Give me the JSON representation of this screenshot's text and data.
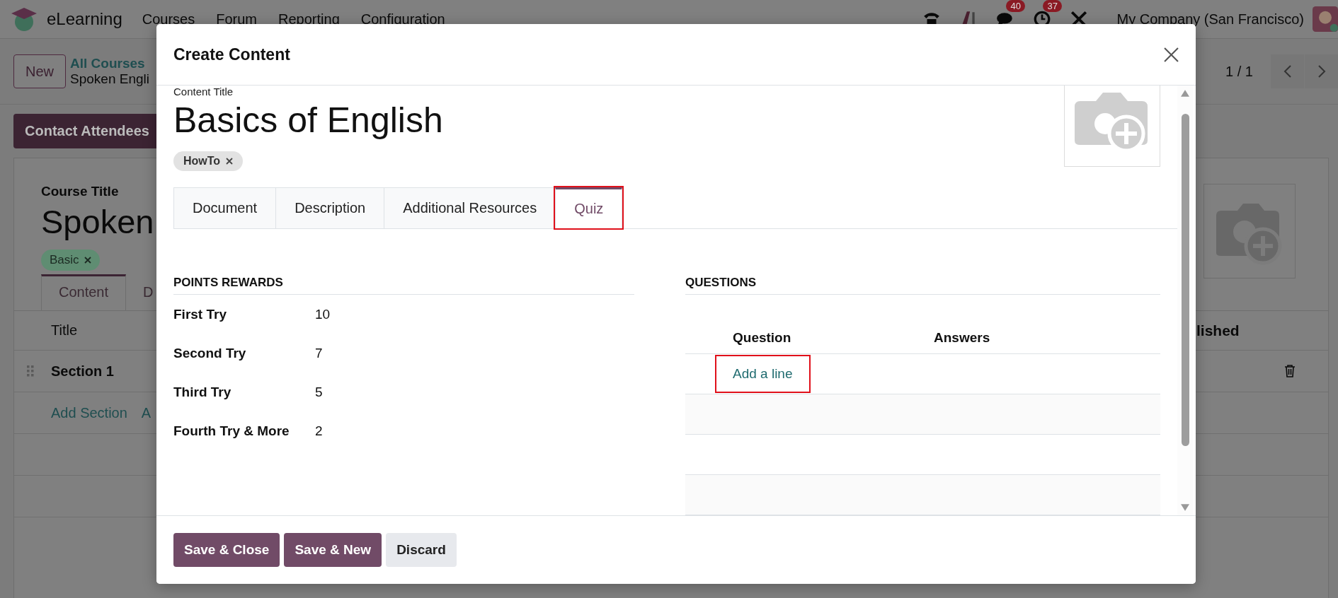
{
  "navbar": {
    "app_name": "eLearning",
    "menu": [
      "Courses",
      "Forum",
      "Reporting",
      "Configuration"
    ],
    "icons": [
      {
        "kind": "phone"
      },
      {
        "kind": "ai"
      },
      {
        "kind": "chat",
        "count": "40"
      },
      {
        "kind": "clock",
        "count": "37"
      },
      {
        "kind": "tools"
      }
    ],
    "company": "My Company (San Francisco)"
  },
  "control_panel": {
    "new_button": "New",
    "breadcrumb": [
      "All Courses",
      "Spoken Engli"
    ],
    "pager": "1 / 1"
  },
  "action_button": "Contact Attendees",
  "course_form": {
    "field_label": "Course Title",
    "title": "Spoken",
    "tag": "Basic",
    "tabs": [
      {
        "label": "Content",
        "selected": true
      },
      {
        "label": "D",
        "selected": false
      }
    ],
    "columns": [
      "Title",
      "lished"
    ],
    "rows": [
      {
        "kind": "section",
        "title": "Section 1"
      }
    ],
    "add_links": [
      "Add Section",
      "A"
    ]
  },
  "dialog": {
    "title": "Create Content",
    "field_label": "Content Title",
    "name": "Basics of English",
    "tags": [
      "HowTo"
    ],
    "tabs": [
      {
        "label": "Document",
        "selected": false,
        "highlighted": false
      },
      {
        "label": "Description",
        "selected": false,
        "highlighted": false
      },
      {
        "label": "Additional Resources",
        "selected": false,
        "highlighted": false
      },
      {
        "label": "Quiz",
        "selected": true,
        "highlighted": true
      }
    ],
    "points": {
      "title": "POINTS REWARDS",
      "rows": [
        {
          "label": "First Try",
          "value": "10"
        },
        {
          "label": "Second Try",
          "value": "7"
        },
        {
          "label": "Third Try",
          "value": "5"
        },
        {
          "label": "Fourth Try & More",
          "value": "2"
        }
      ]
    },
    "questions": {
      "title": "QUESTIONS",
      "columns": [
        "Question",
        "Answers"
      ],
      "add_line": {
        "label": "Add a line",
        "highlighted": true
      }
    },
    "buttons": [
      {
        "label": "Save & Close",
        "kind": "primary"
      },
      {
        "label": "Save & New",
        "kind": "primary"
      },
      {
        "label": "Discard",
        "kind": "secondary"
      }
    ]
  }
}
